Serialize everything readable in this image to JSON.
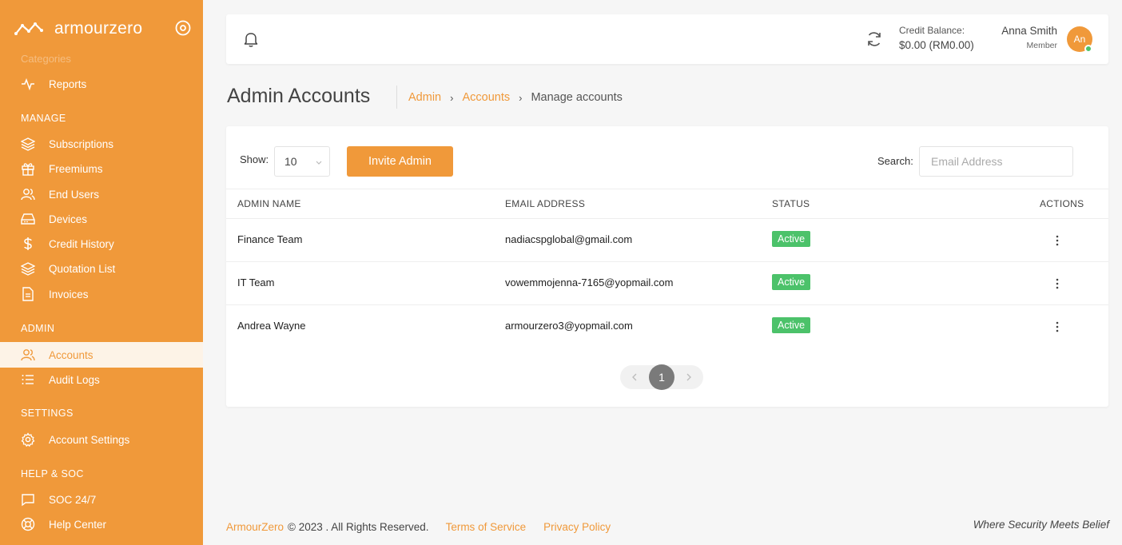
{
  "brand": {
    "name": "armourzero"
  },
  "sidebar": {
    "ghost_item": "Categories",
    "reports": "Reports",
    "sections": {
      "manage": "MANAGE",
      "admin": "ADMIN",
      "settings": "SETTINGS",
      "help": "HELP & SOC"
    },
    "items": {
      "subscriptions": "Subscriptions",
      "freemiums": "Freemiums",
      "end_users": "End Users",
      "devices": "Devices",
      "credit_history": "Credit History",
      "quotation_list": "Quotation List",
      "invoices": "Invoices",
      "accounts": "Accounts",
      "audit_logs": "Audit Logs",
      "account_settings": "Account Settings",
      "soc": "SOC 24/7",
      "help_center": "Help Center"
    },
    "active": "accounts"
  },
  "topbar": {
    "credit_label": "Credit Balance:",
    "credit_value": "$0.00 (RM0.00)",
    "user_name": "Anna Smith",
    "user_role": "Member",
    "avatar_initials": "An"
  },
  "page": {
    "title": "Admin Accounts",
    "breadcrumb": [
      "Admin",
      "Accounts",
      "Manage accounts"
    ]
  },
  "controls": {
    "show_label": "Show:",
    "show_value": "10",
    "invite_button": "Invite Admin",
    "search_label": "Search:",
    "search_placeholder": "Email Address"
  },
  "table": {
    "headers": [
      "ADMIN NAME",
      "EMAIL ADDRESS",
      "STATUS",
      "ACTIONS"
    ],
    "rows": [
      {
        "name": "Finance Team",
        "email": "nadiacspglobal@gmail.com",
        "status": "Active"
      },
      {
        "name": "IT Team",
        "email": "vowemmojenna-7165@yopmail.com",
        "status": "Active"
      },
      {
        "name": "Andrea Wayne",
        "email": "armourzero3@yopmail.com",
        "status": "Active"
      }
    ]
  },
  "pagination": {
    "current": "1"
  },
  "footer": {
    "brand": "ArmourZero",
    "copyright": "© 2023 . All Rights Reserved.",
    "terms": "Terms of Service",
    "privacy": "Privacy Policy",
    "tagline": "Where Security Meets Belief"
  },
  "colors": {
    "accent": "#f0993a",
    "active_badge": "#4cc26a",
    "active_nav_bg": "#fdf3e7"
  }
}
